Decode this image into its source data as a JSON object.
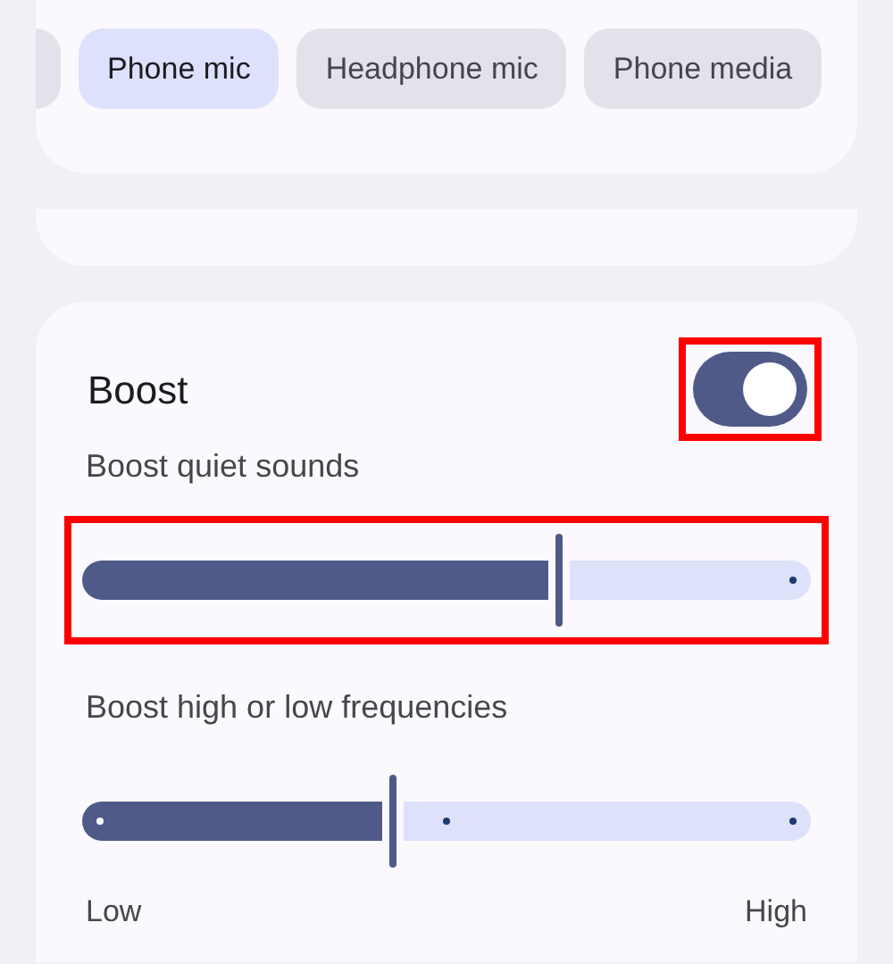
{
  "chips": [
    {
      "selected": false
    },
    {
      "label": "Phone mic",
      "selected": true
    },
    {
      "label": "Headphone mic",
      "selected": false
    },
    {
      "label": "Phone media",
      "selected": false
    }
  ],
  "boost": {
    "title": "Boost",
    "toggle": {
      "on": true,
      "highlighted": true
    },
    "sliders": [
      {
        "label": "Boost quiet sounds",
        "kind": "plain",
        "level": 0.655,
        "highlighted": true
      },
      {
        "label": "Boost high or low frequencies",
        "kind": "bipolar",
        "level": 0.426,
        "highlighted": false,
        "min_label": "Low",
        "max_label": "High"
      }
    ]
  }
}
